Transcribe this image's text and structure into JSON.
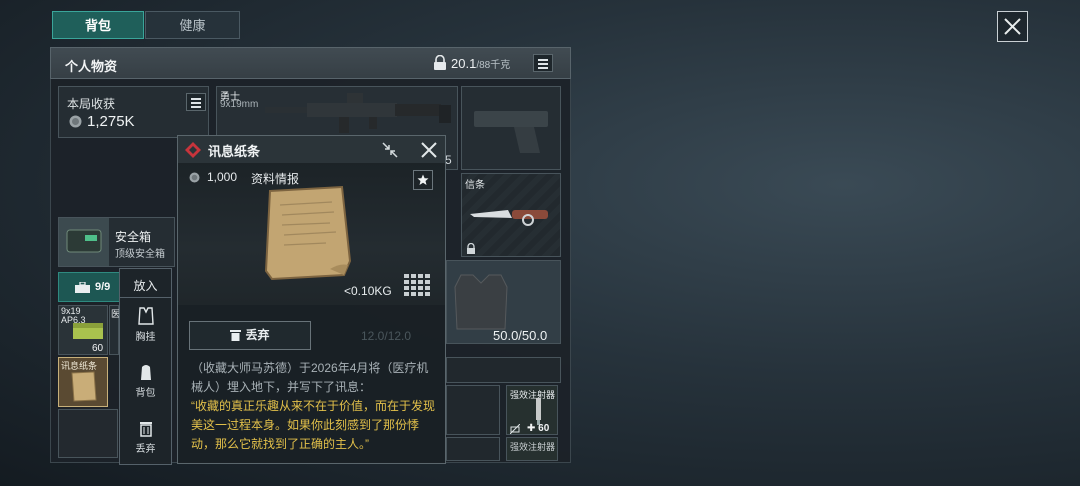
{
  "tabs": [
    {
      "label": "背包",
      "active": true
    },
    {
      "label": "健康",
      "active": false
    }
  ],
  "panel": {
    "title": "个人物资",
    "weight_current": "20.1",
    "weight_max": "/88千克"
  },
  "loot": {
    "title": "本局收获",
    "value": "1,275K"
  },
  "weapon": {
    "name": "勇士",
    "caliber": "9x19mm",
    "ammo_tail": "5"
  },
  "melee": {
    "name": "信条"
  },
  "safe_box": {
    "name": "安全箱",
    "sub": "顶级安全箱"
  },
  "container": {
    "count": "9/9"
  },
  "grid_items": [
    {
      "name": "9x19 AP6.3",
      "qty": "60"
    },
    {
      "name": "医"
    },
    {
      "name": "讯息纸条"
    }
  ],
  "armor": {
    "durability": "50.0/50.0",
    "hidden_durability": "12.0/12.0"
  },
  "injector": {
    "name": "强效注射器",
    "qty": "60",
    "name2": "强效注射器"
  },
  "popup": {
    "title": "讯息纸条",
    "price": "1,000",
    "category": "资料情报",
    "weight": "<0.10KG",
    "discard_label": "丢弃",
    "description": "（收藏大师马苏德）于2026年4月将（医疗机械人）埋入地下，并写下了讯息：",
    "quote": "“收藏的真正乐趣从来不在于价值，而在于发现美这一过程本身。如果你此刻感到了那份悸动，那么它就找到了正确的主人。”"
  },
  "side_menu": {
    "header": "放入",
    "items": [
      {
        "label": "胸挂",
        "icon": "vest-icon"
      },
      {
        "label": "背包",
        "icon": "backpack-icon"
      },
      {
        "label": "丢弃",
        "icon": "trash-icon"
      }
    ]
  },
  "colors": {
    "accent_teal": "#1f5f5a",
    "quote_gold": "#e2c04a",
    "popup_red": "#c8343c"
  }
}
